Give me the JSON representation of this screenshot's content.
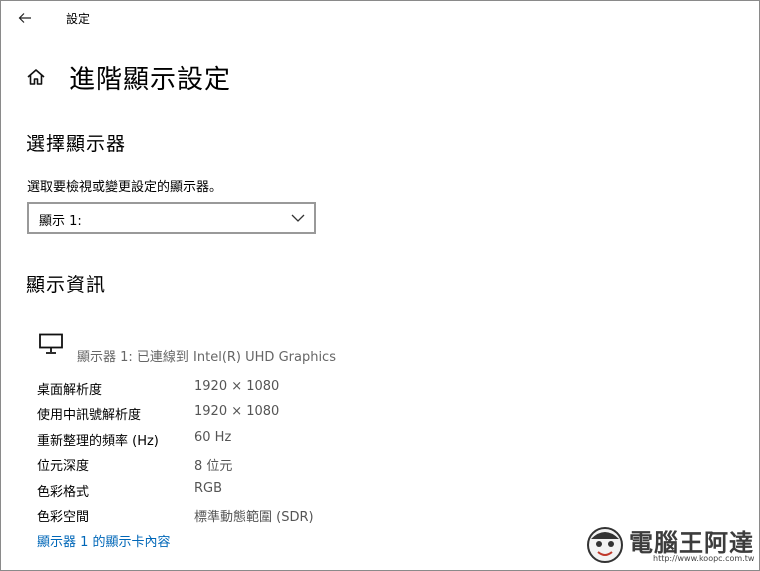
{
  "window": {
    "title": "設定"
  },
  "header": {
    "title": "進階顯示設定"
  },
  "select_display": {
    "heading": "選擇顯示器",
    "description": "選取要檢視或變更設定的顯示器。",
    "dropdown_value": "顯示 1:"
  },
  "display_info": {
    "heading": "顯示資訊",
    "monitor_caption": "顯示器 1: 已連線到 Intel(R) UHD Graphics",
    "rows": [
      {
        "label": "桌面解析度",
        "value": "1920 × 1080"
      },
      {
        "label": "使用中訊號解析度",
        "value": "1920 × 1080"
      },
      {
        "label": "重新整理的頻率 (Hz)",
        "value": "60 Hz"
      },
      {
        "label": "位元深度",
        "value": "8 位元"
      },
      {
        "label": "色彩格式",
        "value": "RGB"
      },
      {
        "label": "色彩空間",
        "value": "標準動態範圍 (SDR)"
      }
    ],
    "adapter_link": "顯示器 1 的顯示卡內容"
  },
  "watermark": {
    "text": "電腦王阿達",
    "url": "http://www.koopc.com.tw"
  },
  "colors": {
    "link": "#0067b8",
    "value_text": "#555555",
    "dropdown_border": "#999999"
  },
  "icons": {
    "back": "back-arrow-icon",
    "home": "home-icon",
    "dropdown": "chevron-down-icon",
    "monitor": "monitor-icon"
  }
}
